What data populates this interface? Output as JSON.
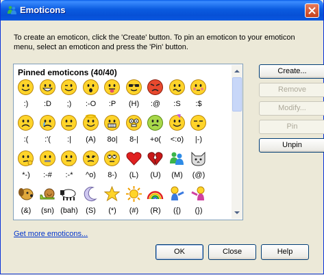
{
  "window": {
    "title": "Emoticons"
  },
  "description": "To create an emoticon, click the 'Create' button. To pin an emoticon to your emoticon menu, select an emoticon and press the 'Pin' button.",
  "list": {
    "header": "Pinned emoticons (40/40)",
    "emoticons": [
      {
        "code": ":)",
        "icon": "smile-icon"
      },
      {
        "code": ":D",
        "icon": "big-grin-icon"
      },
      {
        "code": ";)",
        "icon": "wink-icon"
      },
      {
        "code": ":-O",
        "icon": "surprised-icon"
      },
      {
        "code": ":P",
        "icon": "tongue-out-icon"
      },
      {
        "code": "(H)",
        "icon": "hot-sunglasses-icon"
      },
      {
        "code": ":@",
        "icon": "angry-icon"
      },
      {
        "code": ":S",
        "icon": "confused-icon"
      },
      {
        "code": ":$",
        "icon": "embarrassed-icon"
      },
      {
        "code": ":(",
        "icon": "sad-icon"
      },
      {
        "code": ":'(",
        "icon": "crying-icon"
      },
      {
        "code": ":|",
        "icon": "disappointed-icon"
      },
      {
        "code": "(A)",
        "icon": "angel-icon"
      },
      {
        "code": "8o|",
        "icon": "baring-teeth-icon"
      },
      {
        "code": "8-|",
        "icon": "nerd-icon"
      },
      {
        "code": "+o(",
        "icon": "sick-icon"
      },
      {
        "code": "<:o)",
        "icon": "party-icon"
      },
      {
        "code": "|-)",
        "icon": "sleepy-icon"
      },
      {
        "code": "*-)",
        "icon": "thinking-icon"
      },
      {
        "code": ":-#",
        "icon": "dont-tell-icon"
      },
      {
        "code": ":-*",
        "icon": "secret-icon"
      },
      {
        "code": "^o)",
        "icon": "sarcastic-icon"
      },
      {
        "code": "8-)",
        "icon": "eye-rolling-icon"
      },
      {
        "code": "(L)",
        "icon": "red-heart-icon"
      },
      {
        "code": "(U)",
        "icon": "broken-heart-icon"
      },
      {
        "code": "(M)",
        "icon": "messenger-icon"
      },
      {
        "code": "(@)",
        "icon": "cat-face-icon"
      },
      {
        "code": "(&)",
        "icon": "dog-face-icon"
      },
      {
        "code": "(sn)",
        "icon": "snail-icon"
      },
      {
        "code": "(bah)",
        "icon": "black-sheep-icon"
      },
      {
        "code": "(S)",
        "icon": "moon-icon"
      },
      {
        "code": "(*)",
        "icon": "star-icon"
      },
      {
        "code": "(#)",
        "icon": "sun-icon"
      },
      {
        "code": "(R)",
        "icon": "rainbow-icon"
      },
      {
        "code": "({)",
        "icon": "boy-hug-icon"
      },
      {
        "code": "(})",
        "icon": "girl-hug-icon"
      },
      {
        "code": "",
        "icon": "red-lips-icon"
      },
      {
        "code": "",
        "icon": "red-rose-icon"
      },
      {
        "code": "",
        "icon": "wilted-rose-icon"
      },
      {
        "code": "",
        "icon": "clock-icon"
      }
    ]
  },
  "side_buttons": {
    "create": "Create...",
    "remove": "Remove",
    "modify": "Modify...",
    "pin": "Pin",
    "unpin": "Unpin"
  },
  "more_link": "Get more emoticons...",
  "footer": {
    "ok": "OK",
    "close": "Close",
    "help": "Help"
  },
  "colors": {
    "title_bar": "#0A58E0",
    "face_yellow": "#FFD42A",
    "link": "#0033CC",
    "dialog_bg": "#ECE9D8"
  }
}
